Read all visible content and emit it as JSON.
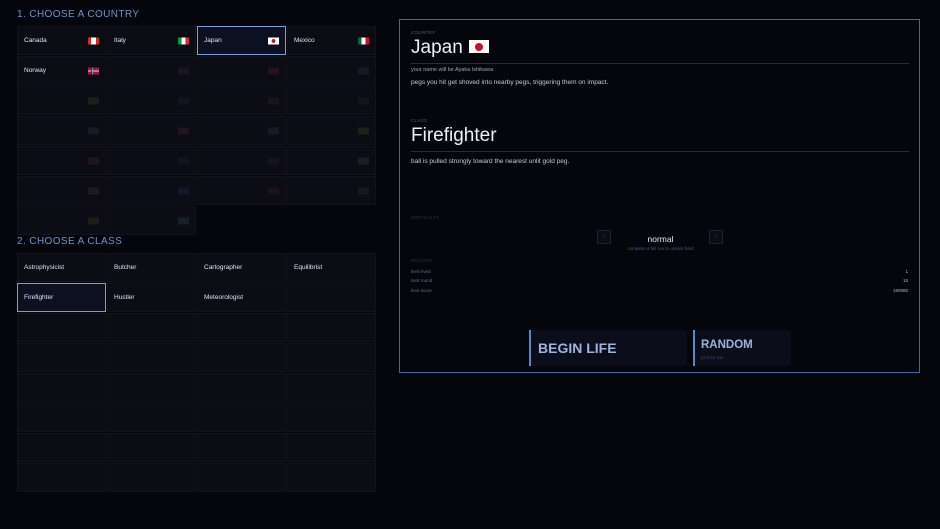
{
  "country_section": {
    "title": "1. CHOOSE A COUNTRY"
  },
  "countries": [
    {
      "label": "Canada",
      "locked": false,
      "selected": false,
      "flag": "canada"
    },
    {
      "label": "Italy",
      "locked": false,
      "selected": false,
      "flag": "italy"
    },
    {
      "label": "Japan",
      "locked": false,
      "selected": true,
      "flag": "japan"
    },
    {
      "label": "Mexico",
      "locked": false,
      "selected": false,
      "flag": "mexico"
    },
    {
      "label": "Norway",
      "locked": false,
      "selected": false,
      "flag": "norway"
    },
    {
      "label": "",
      "locked": true,
      "flag": "generic-a"
    },
    {
      "label": "",
      "locked": true,
      "flag": "generic-b"
    },
    {
      "label": "",
      "locked": true,
      "flag": "generic-c"
    },
    {
      "label": "",
      "locked": true,
      "flag": "generic-d"
    },
    {
      "label": "",
      "locked": true,
      "flag": "generic-e"
    },
    {
      "label": "",
      "locked": true,
      "flag": "generic-f"
    },
    {
      "label": "",
      "locked": true,
      "flag": "generic-g"
    },
    {
      "label": "",
      "locked": true,
      "flag": "generic-h"
    },
    {
      "label": "",
      "locked": true,
      "flag": "generic-i"
    },
    {
      "label": "",
      "locked": true,
      "flag": "generic-j"
    },
    {
      "label": "",
      "locked": true,
      "flag": "generic-k"
    },
    {
      "label": "",
      "locked": true,
      "flag": "generic-l"
    },
    {
      "label": "",
      "locked": true,
      "flag": "generic-m"
    },
    {
      "label": "",
      "locked": true,
      "flag": "generic-n"
    },
    {
      "label": "",
      "locked": true,
      "flag": "generic-o"
    },
    {
      "label": "",
      "locked": true,
      "flag": "generic-p"
    },
    {
      "label": "",
      "locked": true,
      "flag": "generic-q"
    },
    {
      "label": "",
      "locked": true,
      "flag": "generic-r"
    },
    {
      "label": "",
      "locked": true,
      "flag": "generic-s"
    },
    {
      "label": "",
      "locked": true,
      "flag": "generic-t"
    },
    {
      "label": "",
      "locked": true,
      "flag": "generic-u"
    }
  ],
  "class_section": {
    "title": "2. CHOOSE A CLASS"
  },
  "classes": [
    {
      "label": "Astrophysicist",
      "locked": false,
      "selected": false
    },
    {
      "label": "Butcher",
      "locked": false,
      "selected": false
    },
    {
      "label": "Cartographer",
      "locked": false,
      "selected": false
    },
    {
      "label": "Equilibrist",
      "locked": false,
      "selected": false
    },
    {
      "label": "Firefighter",
      "locked": false,
      "selected": true
    },
    {
      "label": "Hustler",
      "locked": false,
      "selected": false
    },
    {
      "label": "Meteorologist",
      "locked": false,
      "selected": false
    },
    {
      "label": "",
      "locked": true
    },
    {
      "label": "",
      "locked": true
    },
    {
      "label": "",
      "locked": true
    },
    {
      "label": "",
      "locked": true
    },
    {
      "label": "",
      "locked": true
    },
    {
      "label": "",
      "locked": true
    },
    {
      "label": "",
      "locked": true
    },
    {
      "label": "",
      "locked": true
    },
    {
      "label": "",
      "locked": true
    },
    {
      "label": "",
      "locked": true
    },
    {
      "label": "",
      "locked": true
    },
    {
      "label": "",
      "locked": true
    },
    {
      "label": "",
      "locked": true
    },
    {
      "label": "",
      "locked": true
    },
    {
      "label": "",
      "locked": true
    },
    {
      "label": "",
      "locked": true
    },
    {
      "label": "",
      "locked": true
    },
    {
      "label": "",
      "locked": true
    },
    {
      "label": "",
      "locked": true
    },
    {
      "label": "",
      "locked": true
    },
    {
      "label": "",
      "locked": true
    },
    {
      "label": "",
      "locked": true
    },
    {
      "label": "",
      "locked": true
    },
    {
      "label": "",
      "locked": true
    },
    {
      "label": "",
      "locked": true
    }
  ],
  "panel": {
    "country_label": "COUNTRY",
    "country_name": "Japan",
    "name_text": "your name will be Ayaka Ishikawa",
    "country_effect": "pegs you hit get shoved into nearby pegs, triggering them on impact.",
    "class_label": "CLASS",
    "class_name": "Firefighter",
    "class_effect": "ball is pulled strongly toward the nearest unlit gold peg.",
    "difficulty_label": "DIFFICULTY",
    "difficulty_value": "normal",
    "difficulty_prev": "‹",
    "difficulty_next": "›",
    "difficulty_hint": "complete a full run to unlock hard",
    "record_label": "RECORD",
    "stats": [
      {
        "label": "lives lived",
        "value": "1"
      },
      {
        "label": "best round",
        "value": "15"
      },
      {
        "label": "best score",
        "value": "150080"
      }
    ],
    "begin_label": "BEGIN LIFE",
    "random_label": "RANDOM",
    "random_sub": "pick for me"
  },
  "colors": {
    "accent": "#6f93c9",
    "panel_border": "#3f6aa9",
    "background": "#05060c"
  }
}
